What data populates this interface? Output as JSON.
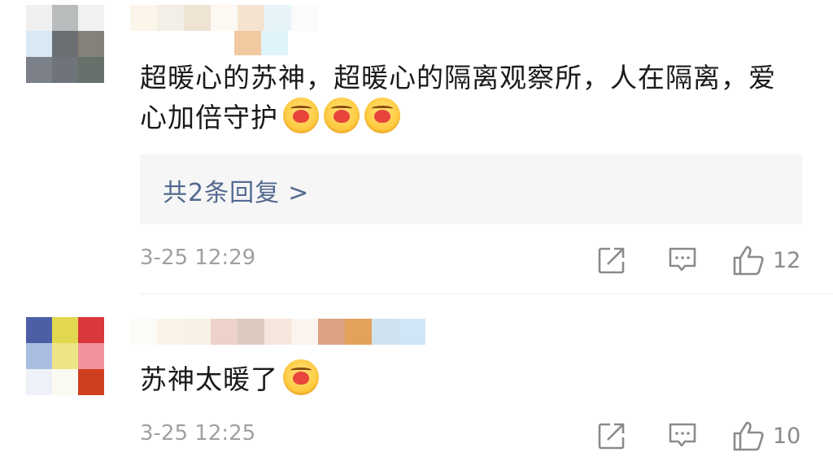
{
  "comments": [
    {
      "text": "超暖心的苏神，超暖心的隔离观察所，人在隔离，爱心加倍守护",
      "emojis": [
        "hug-emoji",
        "hug-emoji",
        "hug-emoji"
      ],
      "replies_label": "共2条回复",
      "replies_arrow": ">",
      "time": "3-25 12:29",
      "likes": "12",
      "avatar_colors": [
        "#f0f0f0",
        "#b9bcbc",
        "#eff1f3",
        "#d9e8f5",
        "#6b6f72",
        "#858179",
        "#7c8189",
        "#6f737a",
        "#67706b"
      ],
      "name_colors": [
        "#fbf5ea",
        "#f3efe6",
        "#efe3d3",
        "#fdf8f2",
        "#f5e3cf",
        "#e6f4f8",
        "#fbfbfb"
      ],
      "name_row2_colors": [
        "#f2c9a0",
        "#dff3fb"
      ]
    },
    {
      "text": "苏神太暖了",
      "emojis": [
        "hug-emoji"
      ],
      "time": "3-25 12:25",
      "likes": "10",
      "avatar_colors": [
        "#4c5fa6",
        "#e2d84f",
        "#d9383c",
        "#a9bde0",
        "#ece486",
        "#f1939c",
        "#eef1f7",
        "#fafaf0",
        "#cf3e1f"
      ],
      "name_colors": [
        "#fcfbf8",
        "#fbf3e8",
        "#f9f1e5",
        "#ecd2c8",
        "#ddc9c0",
        "#f7e6dd",
        "#fbf4ee",
        "#dba384",
        "#e3a15c",
        "#cfe2ef",
        "#cfe6f8"
      ]
    }
  ],
  "icons": {
    "share": "share-icon",
    "reply": "comment-icon",
    "like": "thumbs-up-icon"
  }
}
